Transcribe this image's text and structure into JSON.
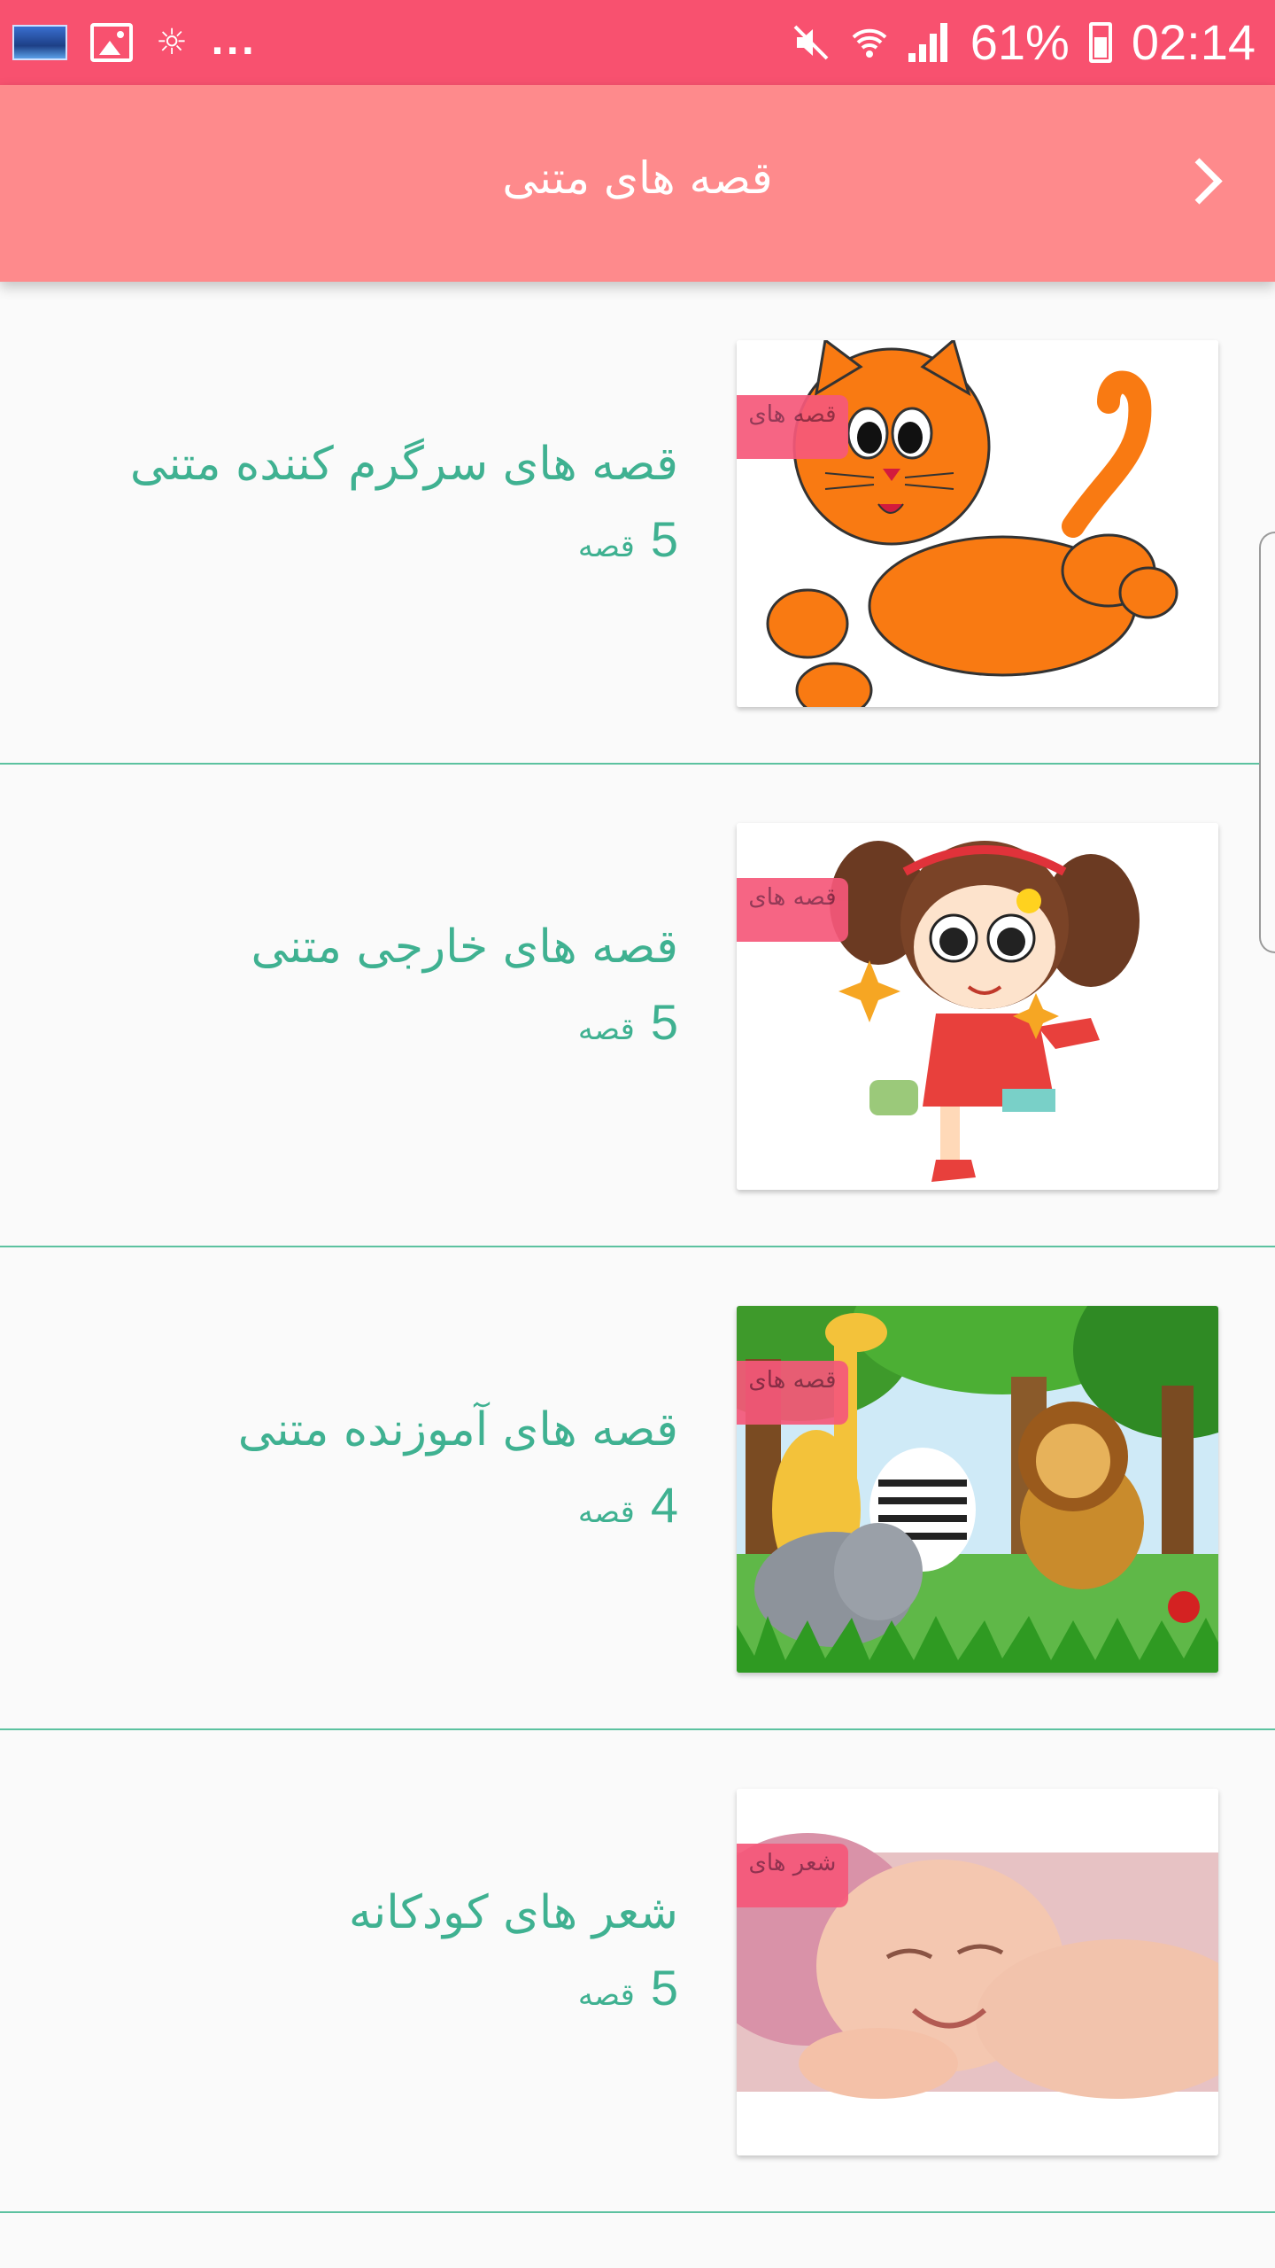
{
  "status_bar": {
    "time": "02:14",
    "battery_percent": "61%",
    "more_dots": "...",
    "icons": [
      "app-thumbnail-icon",
      "image-icon",
      "weather-icon",
      "mute-icon",
      "wifi-icon",
      "signal-icon",
      "battery-icon"
    ]
  },
  "app_bar": {
    "title": "قصه های متنی",
    "back_icon": "chevron-right-icon"
  },
  "colors": {
    "status_bar": "#f8516f",
    "app_bar": "#fe8a8c",
    "accent_text": "#3fb191",
    "divider": "#5cc2a0",
    "tag": "#f6587a"
  },
  "items": [
    {
      "title": "قصه های سرگرم کننده متنی",
      "count": "5",
      "count_unit": "قصه",
      "tag": "قصه های",
      "image": "orange-cat-illustration"
    },
    {
      "title": "قصه های خارجی متنی",
      "count": "5",
      "count_unit": "قصه",
      "tag": "قصه های",
      "image": "cartoon-girl-illustration"
    },
    {
      "title": "قصه های آموزنده متنی",
      "count": "4",
      "count_unit": "قصه",
      "tag": "قصه های",
      "image": "jungle-animals-illustration"
    },
    {
      "title": "شعر های کودکانه",
      "count": "5",
      "count_unit": "قصه",
      "tag": "شعر های",
      "image": "sleeping-baby-photo"
    }
  ]
}
